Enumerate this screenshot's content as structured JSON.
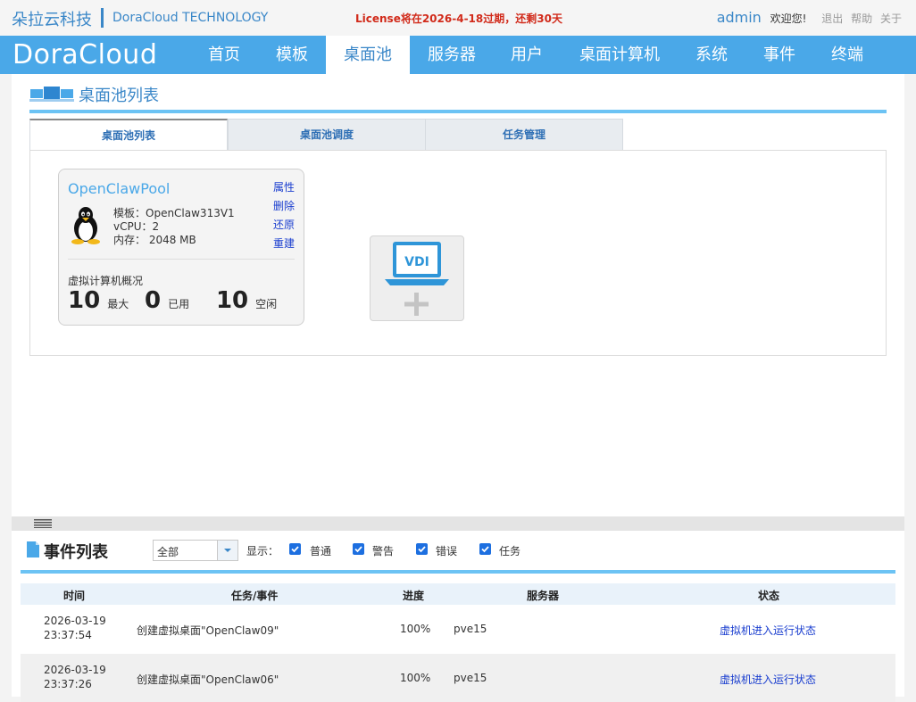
{
  "header": {
    "brand_cn": "朵拉云科技",
    "brand_en": "DoraCloud TECHNOLOGY",
    "license": "License将在2026-4-18过期，还剩30天",
    "username": "admin",
    "welcome": "欢迎您!",
    "logout": "退出",
    "help": "帮助",
    "about": "关于"
  },
  "nav": {
    "logo": "DoraCloud",
    "items": [
      "首页",
      "模板",
      "桌面池",
      "服务器",
      "用户",
      "桌面计算机",
      "系统",
      "事件",
      "终端"
    ],
    "active_index": 2
  },
  "page": {
    "title": "桌面池列表",
    "tabs": [
      "桌面池列表",
      "桌面池调度",
      "任务管理"
    ],
    "active_tab": 0
  },
  "pool": {
    "name": "OpenClawPool",
    "actions": [
      "属性",
      "删除",
      "还原",
      "重建"
    ],
    "template": "模板：OpenClaw313V1",
    "vcpu": "vCPU：2",
    "memory": "内存：  2048 MB",
    "summary_label": "虚拟计算机概况",
    "max": "10",
    "max_label": "最大",
    "used": "0",
    "used_label": "已用",
    "free": "10",
    "free_label": "空闲",
    "os_icon": "linux-penguin-icon"
  },
  "add_card": {
    "label": "VDI",
    "icon": "add-vdi-icon"
  },
  "events": {
    "title": "事件列表",
    "filter_value": "全部",
    "show_label": "显示：",
    "checkboxes": [
      {
        "label": "普通",
        "checked": true
      },
      {
        "label": "警告",
        "checked": true
      },
      {
        "label": "错误",
        "checked": true
      },
      {
        "label": "任务",
        "checked": true
      }
    ],
    "columns": [
      "时间",
      "任务/事件",
      "进度",
      "服务器",
      "状态"
    ],
    "rows": [
      {
        "date": "2026-03-19",
        "time": "23:37:54",
        "task": "创建虚拟桌面\"OpenClaw09\"",
        "progress": "100%",
        "server": "pve15",
        "status": "虚拟机进入运行状态"
      },
      {
        "date": "2026-03-19",
        "time": "23:37:26",
        "task": "创建虚拟桌面\"OpenClaw06\"",
        "progress": "100%",
        "server": "pve15",
        "status": "虚拟机进入运行状态"
      }
    ]
  },
  "colors": {
    "nav_bg": "#4aa8e8",
    "accent": "#3a87c8",
    "license_red": "#d12a1a",
    "link_blue": "#1a3ecf",
    "checkbox_blue": "#1d6fe0"
  }
}
